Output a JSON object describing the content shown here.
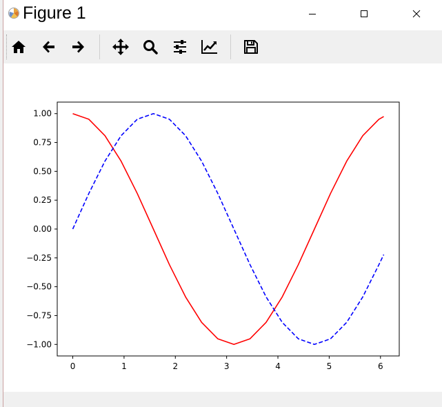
{
  "window": {
    "title": "Figure 1",
    "controls": [
      "minimize",
      "maximize",
      "close"
    ]
  },
  "toolbar": {
    "buttons": [
      {
        "name": "home",
        "icon": "home-icon",
        "tooltip": "Reset original view"
      },
      {
        "name": "back",
        "icon": "arrow-left-icon",
        "tooltip": "Back to previous view"
      },
      {
        "name": "forward",
        "icon": "arrow-right-icon",
        "tooltip": "Forward to next view"
      },
      {
        "name": "pan",
        "icon": "move-icon",
        "tooltip": "Pan axes"
      },
      {
        "name": "zoom",
        "icon": "zoom-icon",
        "tooltip": "Zoom to rectangle"
      },
      {
        "name": "subplots",
        "icon": "sliders-icon",
        "tooltip": "Configure subplots"
      },
      {
        "name": "customize",
        "icon": "chart-line-icon",
        "tooltip": "Edit axis, curve and image parameters"
      },
      {
        "name": "save",
        "icon": "save-icon",
        "tooltip": "Save the figure"
      }
    ]
  },
  "status": {
    "text": ""
  },
  "chart_data": {
    "type": "line",
    "title": "",
    "xlabel": "",
    "ylabel": "",
    "xlim": [
      -0.303,
      6.366
    ],
    "ylim": [
      -1.1,
      1.1
    ],
    "grid": false,
    "xticks": [
      0,
      1,
      2,
      3,
      4,
      5,
      6
    ],
    "yticks": [
      1.0,
      0.75,
      0.5,
      0.25,
      0.0,
      -0.25,
      -0.5,
      -0.75,
      -1.0
    ],
    "xtick_labels": [
      "0",
      "1",
      "2",
      "3",
      "4",
      "5",
      "6"
    ],
    "ytick_labels": [
      "1.00",
      "0.75",
      "0.50",
      "0.25",
      "0.00",
      "−0.25",
      "−0.50",
      "−0.75",
      "−1.00"
    ],
    "x": [
      0.0,
      0.314,
      0.628,
      0.942,
      1.257,
      1.571,
      1.885,
      2.199,
      2.513,
      2.827,
      3.142,
      3.456,
      3.77,
      4.084,
      4.398,
      4.712,
      5.027,
      5.341,
      5.655,
      5.969,
      6.063
    ],
    "series": [
      {
        "color": "#ff0000",
        "style": "solid",
        "values": [
          1.0,
          0.951,
          0.809,
          0.588,
          0.309,
          0.0,
          -0.309,
          -0.588,
          -0.809,
          -0.951,
          -1.0,
          -0.951,
          -0.809,
          -0.588,
          -0.309,
          0.0,
          0.309,
          0.588,
          0.809,
          0.951,
          0.975
        ]
      },
      {
        "color": "#0000ff",
        "style": "dashed",
        "values": [
          0.0,
          0.309,
          0.588,
          0.809,
          0.951,
          1.0,
          0.951,
          0.809,
          0.588,
          0.309,
          0.0,
          -0.309,
          -0.588,
          -0.809,
          -0.951,
          -1.0,
          -0.951,
          -0.809,
          -0.588,
          -0.309,
          -0.222
        ]
      }
    ]
  }
}
